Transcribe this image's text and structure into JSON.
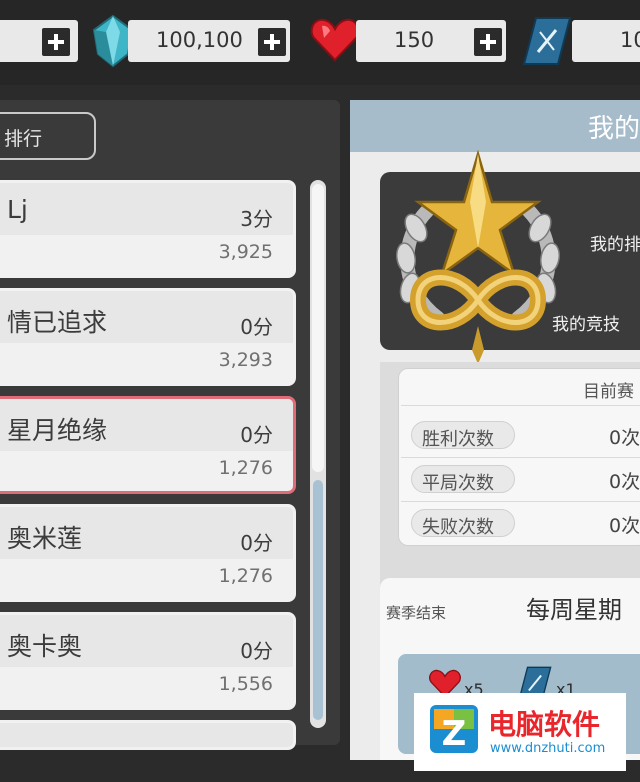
{
  "topbar": {
    "resources": [
      {
        "name": "coin",
        "value": "",
        "icon": "coin-icon"
      },
      {
        "name": "diamond",
        "value": "100,100",
        "icon": "diamond-icon",
        "color": "#3fb6c8"
      },
      {
        "name": "heart",
        "value": "150",
        "icon": "heart-icon",
        "color": "#e0202a"
      },
      {
        "name": "ticket",
        "value": "10",
        "icon": "ticket-icon",
        "color": "#2b6e9a"
      }
    ]
  },
  "leaderboard": {
    "tab_label": "排行",
    "rows": [
      {
        "name": "Lj",
        "score": "3分",
        "points": "3,925",
        "selected": false
      },
      {
        "name": "情已追求",
        "score": "0分",
        "points": "3,293",
        "selected": false
      },
      {
        "name": "星月绝缘",
        "score": "0分",
        "points": "1,276",
        "selected": true
      },
      {
        "name": "奥米莲",
        "score": "0分",
        "points": "1,276",
        "selected": false
      },
      {
        "name": "奥卡奥",
        "score": "0分",
        "points": "1,556",
        "selected": false
      }
    ]
  },
  "profile": {
    "header": "我的",
    "badge_line1": "我的排",
    "badge_line2": "我的竞技",
    "stats_title": "目前赛",
    "stats": [
      {
        "label": "胜利次数",
        "value": "0次"
      },
      {
        "label": "平局次数",
        "value": "0次"
      },
      {
        "label": "失败次数",
        "value": "0次"
      }
    ],
    "season_label": "赛季结束",
    "season_value": "每周星期",
    "rewards": [
      {
        "icon": "heart-icon",
        "value": "x5"
      },
      {
        "icon": "ticket-icon",
        "value": "x1"
      }
    ]
  },
  "watermark": {
    "title": "电脑软件",
    "url": "www.dnzhuti.com"
  },
  "colors": {
    "accent": "#a6bccb",
    "selected_border": "#e06c78",
    "dark_bg": "#2b2b2b"
  }
}
